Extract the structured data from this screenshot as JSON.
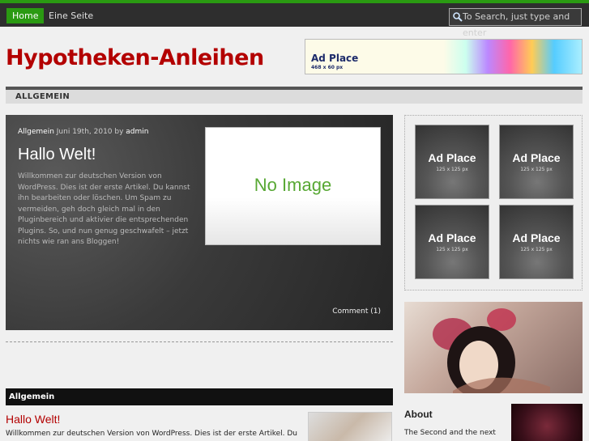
{
  "nav": {
    "home_label": "Home",
    "items": [
      "Eine Seite"
    ],
    "search_placeholder": "To Search, just type and enter"
  },
  "site": {
    "title": "Hypotheken-Anleihen"
  },
  "banner_ad": {
    "title": "Ad Place",
    "size": "468 x 60 px"
  },
  "category_bar": {
    "label": "ALLGEMEIN"
  },
  "featured": {
    "category": "Allgemein",
    "date": " Juni 19th, 2010 by ",
    "author": "admin",
    "title": "Hallo Welt!",
    "excerpt": "Willkommen zur deutschen Version von WordPress. Dies ist der erste Artikel. Du kannst ihn bearbeiten oder löschen. Um Spam zu vermeiden, geh doch gleich mal in den Pluginbereich und aktivier die entsprechenden Plugins. So, und nun genug geschwafelt – jetzt nichts wie ran ans Bloggen!",
    "image_placeholder": "No Image",
    "comment_label": "Comment (1)"
  },
  "section": {
    "heading": "Allgemein",
    "post_title": "Hallo Welt!",
    "post_excerpt": "Willkommen zur deutschen Version von WordPress. Dies ist der erste Artikel. Du"
  },
  "sidebar": {
    "ads": [
      {
        "title": "Ad Place",
        "size": "125 x 125 px"
      },
      {
        "title": "Ad Place",
        "size": "125 x 125 px"
      },
      {
        "title": "Ad Place",
        "size": "125 x 125 px"
      },
      {
        "title": "Ad Place",
        "size": "125 x 125 px"
      }
    ],
    "about_title": "About",
    "about_text": "The Second and the next"
  },
  "colors": {
    "accent_green": "#2a9a12",
    "title_red": "#b30000",
    "noimage_green": "#58a834"
  }
}
